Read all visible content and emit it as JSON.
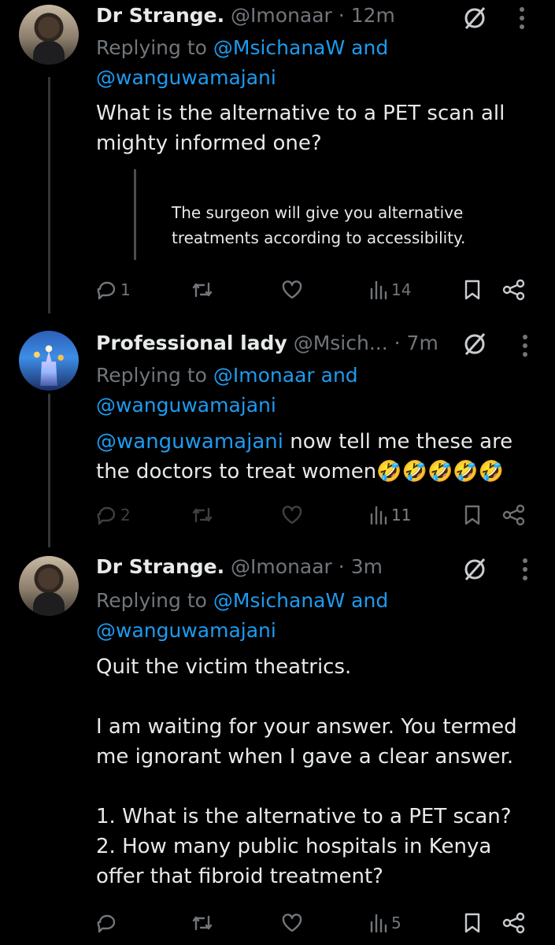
{
  "tweets": [
    {
      "name": "Dr Strange.",
      "handle": "@Imonaar",
      "time": "· 12m",
      "replying_prefix": "Replying to ",
      "replying_user1": "@MsichanaW",
      "replying_and": " and",
      "replying_user2": "@wanguwamajani",
      "body": "What is the alternative to a PET scan all mighty informed one?",
      "quote": "The surgeon will give you alternative treatments according to accessibility.",
      "replies": "1",
      "retweets": "",
      "likes": "",
      "views": "14"
    },
    {
      "name": "Professional lady",
      "handle": "@Msich...",
      "time": "· 7m",
      "replying_prefix": "Replying to ",
      "replying_user1": "@Imonaar",
      "replying_and": " and",
      "replying_user2": "@wanguwamajani",
      "body_mention": "@wanguwamajani",
      "body": " now tell me these are the doctors to treat women🤣🤣🤣🤣🤣",
      "replies": "2",
      "views": "11"
    },
    {
      "name": "Dr Strange.",
      "handle": "@Imonaar",
      "time": "· 3m",
      "replying_prefix": "Replying to ",
      "replying_user1": "@MsichanaW",
      "replying_and": " and",
      "replying_user2": "@wanguwamajani",
      "body": "Quit the victim theatrics.\n\nI am waiting for your answer. You termed me ignorant when I gave a clear answer.\n\n1. What is the alternative to a PET scan?\n2. How many public hospitals in Kenya offer that fibroid treatment?",
      "replies": "",
      "views": "5"
    }
  ],
  "icons": {
    "reply": "reply-icon",
    "retweet": "retweet-icon",
    "like": "like-icon",
    "views": "views-icon",
    "bookmark": "bookmark-icon",
    "share": "share-icon",
    "grok": "grok-icon",
    "more": "more-icon"
  },
  "colors": {
    "background": "#000000",
    "text": "#e7e9ea",
    "muted": "#71767b",
    "link": "#1d9bf0",
    "thread_line": "#333639"
  }
}
